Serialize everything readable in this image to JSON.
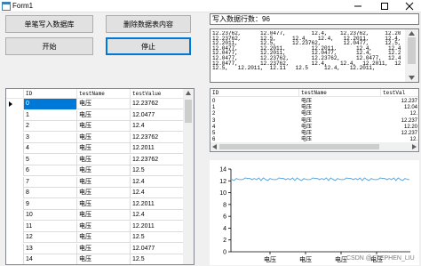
{
  "window": {
    "title": "Form1"
  },
  "buttons": {
    "single_write": "单笔写入数据库",
    "delete_table": "删除数据表内容",
    "start": "开始",
    "stop": "停止"
  },
  "rows_label": "写入数据行数：96",
  "text_lines": [
    "12.23762,      12.0477,        12.4,    12.23762,     12.2011,",
    "12.23762,      12.5,     12.4,   12.4,   12.2011,     12.4,",
    "12.2011,       12.5,     12.23762,       12.0477,     12.5,",
    "12.0477,       12.2011,        12.2011,      12.4,     12.4,",
    "12.0477,       12.2011,        12.0477,      12.4,     12.2011,",
    "12.0477,       12.23762,       12.23762,     12.0477,  12.4,",
    "12.0477,       12.23762,       12.4,    12.4,  12.2011,  12.4,",
    "12.5,   12.2011,  12.11   12.5     12.4,   12.2011,"
  ],
  "main_grid": {
    "columns": [
      "ID",
      "testName",
      "testValue"
    ],
    "rows": [
      {
        "id": "0",
        "name": "电压",
        "value": "12.23762"
      },
      {
        "id": "1",
        "name": "电压",
        "value": "12.0477"
      },
      {
        "id": "2",
        "name": "电压",
        "value": "12.4"
      },
      {
        "id": "3",
        "name": "电压",
        "value": "12.23762"
      },
      {
        "id": "4",
        "name": "电压",
        "value": "12.2011"
      },
      {
        "id": "5",
        "name": "电压",
        "value": "12.23762"
      },
      {
        "id": "6",
        "name": "电压",
        "value": "12.5"
      },
      {
        "id": "7",
        "name": "电压",
        "value": "12.4"
      },
      {
        "id": "8",
        "name": "电压",
        "value": "12.4"
      },
      {
        "id": "9",
        "name": "电压",
        "value": "12.2011"
      },
      {
        "id": "10",
        "name": "电压",
        "value": "12.4"
      },
      {
        "id": "11",
        "name": "电压",
        "value": "12.2011"
      },
      {
        "id": "12",
        "name": "电压",
        "value": "12.5"
      },
      {
        "id": "13",
        "name": "电压",
        "value": "12.0477"
      },
      {
        "id": "14",
        "name": "电压",
        "value": "12.5"
      }
    ]
  },
  "small_grid": {
    "columns": [
      "ID",
      "testName",
      "testVal"
    ],
    "rows": [
      {
        "id": "0",
        "name": "电压",
        "value": "12.237"
      },
      {
        "id": "1",
        "name": "电压",
        "value": "12.04"
      },
      {
        "id": "2",
        "name": "电压",
        "value": "12."
      },
      {
        "id": "3",
        "name": "电压",
        "value": "12.237"
      },
      {
        "id": "4",
        "name": "电压",
        "value": "12.20"
      },
      {
        "id": "5",
        "name": "电压",
        "value": "12.237"
      },
      {
        "id": "6",
        "name": "电压",
        "value": "12."
      }
    ]
  },
  "chart_data": {
    "type": "line",
    "yticks": [
      "0",
      "2",
      "4",
      "6",
      "8",
      "10",
      "12",
      "14"
    ],
    "ylim": [
      0,
      14
    ],
    "xticks": [
      "电压",
      "电压",
      "电压",
      "电压"
    ],
    "series": [
      {
        "color": "#4ba3e3",
        "values": [
          12.24,
          12.05,
          12.4,
          12.24,
          12.2,
          12.24,
          12.5,
          12.4,
          12.4,
          12.2,
          12.4,
          12.2,
          12.5,
          12.05,
          12.5,
          12.24,
          12.05,
          12.4,
          12.24,
          12.2,
          12.24,
          12.5,
          12.4,
          12.4,
          12.2,
          12.4,
          12.2,
          12.5,
          12.05,
          12.5,
          12.24,
          12.05,
          12.4,
          12.24,
          12.2,
          12.24,
          12.5,
          12.4,
          12.4,
          12.2,
          12.4,
          12.2,
          12.5,
          12.05,
          12.5,
          12.24,
          12.05,
          12.4,
          12.24,
          12.2,
          12.24,
          12.5,
          12.4,
          12.4,
          12.2,
          12.4,
          12.2,
          12.5,
          12.05,
          12.5,
          12.24,
          12.05,
          12.4,
          12.24,
          12.2,
          12.24,
          12.5,
          12.4,
          12.4,
          12.2,
          12.4,
          12.2,
          12.5,
          12.05,
          12.5,
          12.24,
          12.05,
          12.4,
          12.24,
          12.2
        ]
      }
    ],
    "grid": false
  },
  "watermark": "CSDN @STEPHEN_LIU"
}
